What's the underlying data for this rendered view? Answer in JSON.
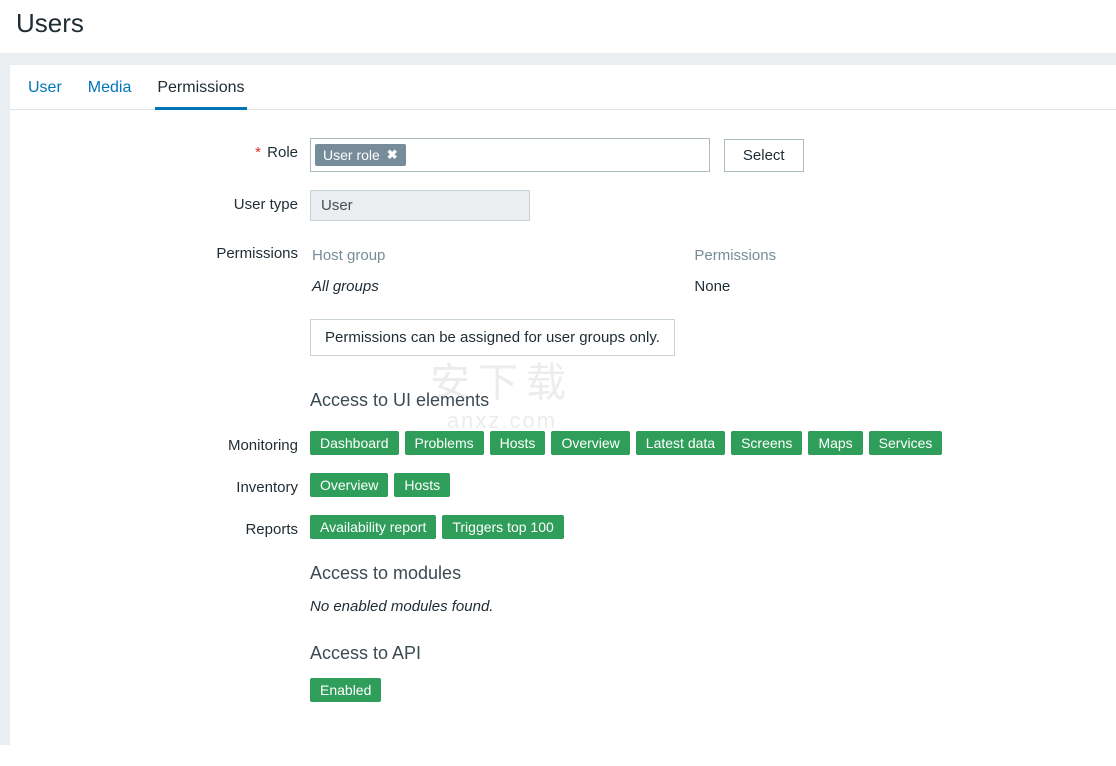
{
  "page": {
    "title": "Users"
  },
  "tabs": {
    "user": "User",
    "media": "Media",
    "permissions": "Permissions",
    "active": "permissions"
  },
  "role": {
    "label": "Role",
    "required": true,
    "value": "User role",
    "select_button": "Select"
  },
  "user_type": {
    "label": "User type",
    "value": "User"
  },
  "permissions_block": {
    "label": "Permissions",
    "columns": {
      "host_group": "Host group",
      "permissions": "Permissions"
    },
    "rows": [
      {
        "host_group": "All groups",
        "permission": "None"
      }
    ],
    "note": "Permissions can be assigned for user groups only."
  },
  "access_ui": {
    "title": "Access to UI elements",
    "rows": {
      "monitoring": {
        "label": "Monitoring",
        "items": [
          "Dashboard",
          "Problems",
          "Hosts",
          "Overview",
          "Latest data",
          "Screens",
          "Maps",
          "Services"
        ]
      },
      "inventory": {
        "label": "Inventory",
        "items": [
          "Overview",
          "Hosts"
        ]
      },
      "reports": {
        "label": "Reports",
        "items": [
          "Availability report",
          "Triggers top 100"
        ]
      }
    }
  },
  "access_modules": {
    "title": "Access to modules",
    "note": "No enabled modules found."
  },
  "access_api": {
    "title": "Access to API",
    "status": "Enabled"
  },
  "watermark": {
    "cn": "安下载",
    "en": "anxz.com"
  }
}
